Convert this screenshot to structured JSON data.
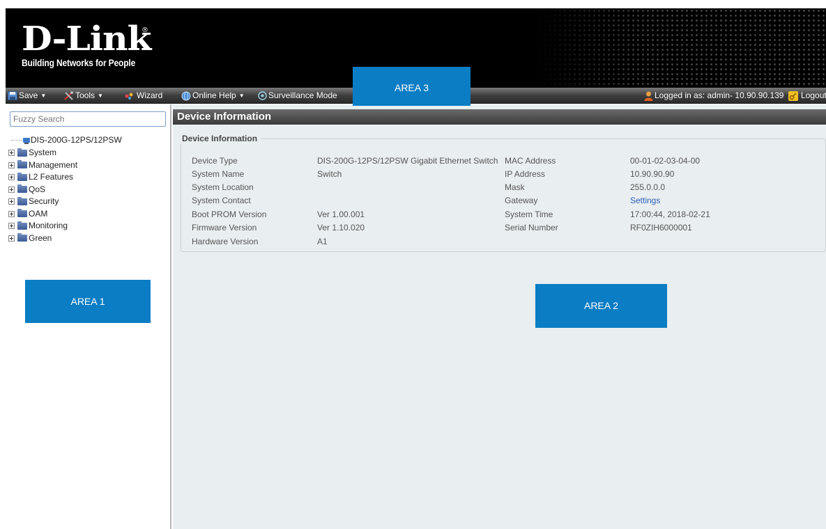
{
  "brand": {
    "logo_text": "D-Link",
    "tagline": "Building Networks for People"
  },
  "toolbar": {
    "save": "Save",
    "tools": "Tools",
    "wizard": "Wizard",
    "online_help": "Online Help",
    "surveillance": "Surveillance Mode",
    "logged_in": "Logged in as: admin- 10.90.90.139",
    "logout": "Logout"
  },
  "areas": {
    "area1": "AREA 1",
    "area2": "AREA 2",
    "area3": "AREA 3"
  },
  "sidebar": {
    "search_placeholder": "Fuzzy Search",
    "root": "DIS-200G-12PS/12PSW",
    "items": [
      {
        "label": "System"
      },
      {
        "label": "Management"
      },
      {
        "label": "L2 Features"
      },
      {
        "label": "QoS"
      },
      {
        "label": "Security"
      },
      {
        "label": "OAM"
      },
      {
        "label": "Monitoring"
      },
      {
        "label": "Green"
      }
    ]
  },
  "main": {
    "title": "Device Information",
    "section_title": "Device Information",
    "left_fields": [
      {
        "label": "Device Type",
        "value": "DIS-200G-12PS/12PSW Gigabit Ethernet Switch"
      },
      {
        "label": "System Name",
        "value": "Switch"
      },
      {
        "label": "System Location",
        "value": ""
      },
      {
        "label": "System Contact",
        "value": ""
      },
      {
        "label": "Boot PROM Version",
        "value": "Ver 1.00.001"
      },
      {
        "label": "Firmware Version",
        "value": "Ver 1.10.020"
      },
      {
        "label": "Hardware Version",
        "value": "A1"
      }
    ],
    "right_fields": [
      {
        "label": "MAC Address",
        "value": "00-01-02-03-04-00"
      },
      {
        "label": "IP Address",
        "value": "10.90.90.90"
      },
      {
        "label": "Mask",
        "value": "255.0.0.0"
      },
      {
        "label": "Gateway",
        "value": "Settings"
      },
      {
        "label": "System Time",
        "value": "17:00:44, 2018-02-21"
      },
      {
        "label": "Serial Number",
        "value": "RF0ZIH6000001"
      }
    ]
  }
}
